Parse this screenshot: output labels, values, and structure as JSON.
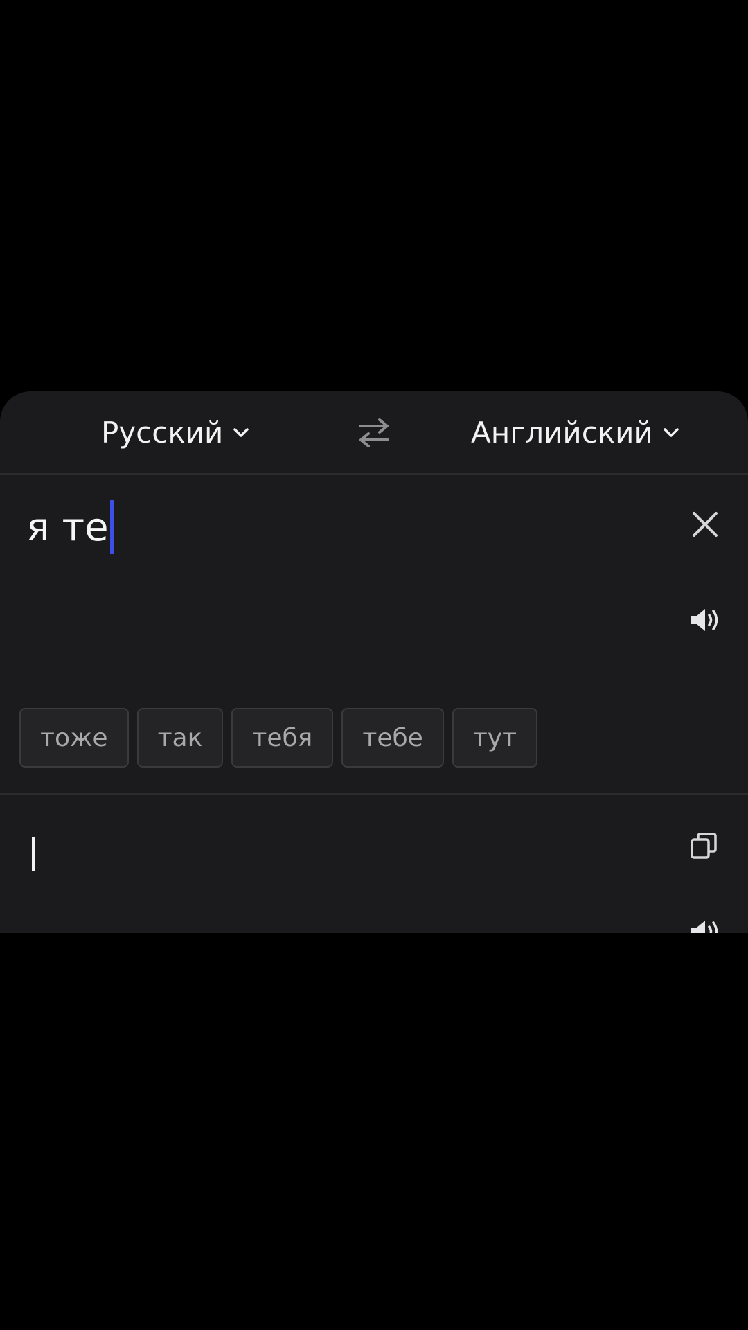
{
  "languages": {
    "source": "Русский",
    "target": "Английский"
  },
  "input": {
    "text": "я те"
  },
  "suggestions": [
    "тоже",
    "так",
    "тебя",
    "тебе",
    "тут"
  ],
  "output": {
    "text": ""
  },
  "colors": {
    "panel_bg": "#1b1b1d",
    "caret": "#3d4fe6",
    "chip_text": "#a9a9ab"
  },
  "icons": [
    "chevron-down-icon",
    "swap-icon",
    "close-icon",
    "speaker-icon",
    "copy-icon"
  ]
}
